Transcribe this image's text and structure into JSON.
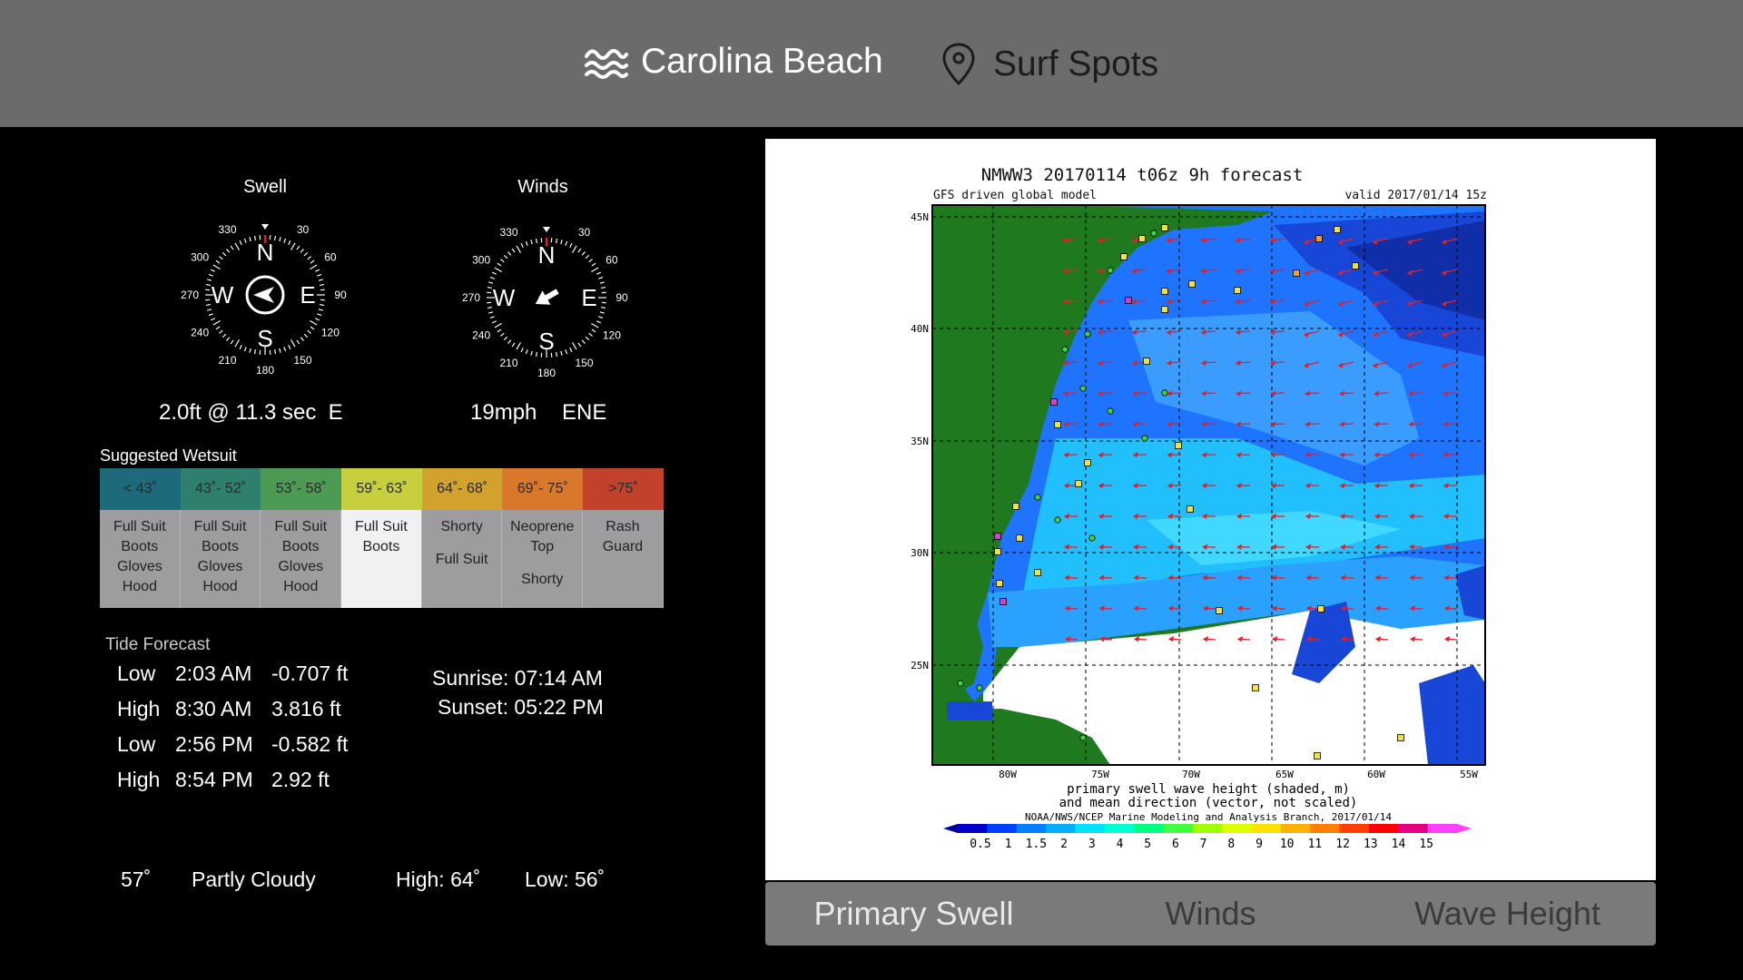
{
  "header": {
    "location_label": "Carolina Beach",
    "spots_label": "Surf Spots",
    "location_icon": "waves-icon",
    "spots_icon": "map-pin-icon"
  },
  "swell": {
    "title": "Swell",
    "readout": "2.0ft @ 11.3 sec  E",
    "direction_deg": 90
  },
  "winds": {
    "title": "Winds",
    "speed": "19mph",
    "direction": "ENE",
    "direction_deg": 60
  },
  "compass": {
    "cardinals": [
      "N",
      "E",
      "S",
      "W"
    ],
    "degree_labels": [
      "30",
      "60",
      "90",
      "120",
      "150",
      "180",
      "210",
      "240",
      "270",
      "300",
      "330"
    ]
  },
  "wetsuit": {
    "title": "Suggested Wetsuit",
    "columns": [
      {
        "range": "< 43˚",
        "color": "#1d6b7a",
        "items": [
          "Full Suit",
          "Boots",
          "Gloves",
          "Hood"
        ]
      },
      {
        "range": "43˚- 52˚",
        "color": "#2f7f6f",
        "items": [
          "Full Suit",
          "Boots",
          "Gloves",
          "Hood"
        ]
      },
      {
        "range": "53˚- 58˚",
        "color": "#4d9a55",
        "items": [
          "Full Suit",
          "Boots",
          "Gloves",
          "Hood"
        ]
      },
      {
        "range": "59˚- 63˚",
        "color": "#c8cf3e",
        "items": [
          "Full Suit",
          "Boots"
        ]
      },
      {
        "range": "64˚- 68˚",
        "color": "#d3a22e",
        "items": [
          "Shorty",
          "Full Suit"
        ]
      },
      {
        "range": "69˚- 75˚",
        "color": "#d9782b",
        "items": [
          "Neoprene",
          "Top",
          "Shorty"
        ]
      },
      {
        "range": ">75˚",
        "color": "#c2412a",
        "items": [
          "Rash",
          "Guard"
        ]
      }
    ],
    "selected_index": 3
  },
  "tide": {
    "title": "Tide Forecast",
    "entries": [
      {
        "type": "Low",
        "time": "2:03 AM",
        "height": "-0.707 ft"
      },
      {
        "type": "High",
        "time": "8:30 AM",
        "height": "3.816 ft"
      },
      {
        "type": "Low",
        "time": "2:56 PM",
        "height": "-0.582 ft"
      },
      {
        "type": "High",
        "time": "8:54 PM",
        "height": "2.92 ft"
      }
    ],
    "sunrise": "Sunrise: 07:14 AM",
    "sunset": "Sunset: 05:22 PM"
  },
  "weather": {
    "temp": "57˚",
    "condition": "Partly Cloudy",
    "high": "High: 64˚",
    "low": "Low: 56˚"
  },
  "map": {
    "title": "NMWW3  20170114  t06z        9h  forecast",
    "subtitle_left": "GFS driven global model",
    "subtitle_right": "valid 2017/01/14  15z",
    "lat_labels": [
      "45N",
      "40N",
      "35N",
      "30N",
      "25N"
    ],
    "lon_labels": [
      "80W",
      "75W",
      "70W",
      "65W",
      "60W",
      "55W"
    ],
    "caption_1": "primary swell wave height (shaded, m)",
    "caption_2": "and mean direction (vector, not scaled)",
    "credit": "NOAA/NWS/NCEP Marine Modeling and Analysis Branch, 2017/01/14",
    "colorbar_labels": [
      "0.5",
      "1",
      "1.5",
      "2",
      "3",
      "4",
      "5",
      "6",
      "7",
      "8",
      "9",
      "10",
      "11",
      "12",
      "13",
      "14",
      "15"
    ],
    "colorbar_colors": [
      "#0000c8",
      "#0040ff",
      "#0080ff",
      "#00b0ff",
      "#00e0ff",
      "#00ffd0",
      "#00ff80",
      "#40ff40",
      "#a0ff00",
      "#e0ff00",
      "#ffe000",
      "#ffb000",
      "#ff8000",
      "#ff4000",
      "#ff0000",
      "#e00080",
      "#ff40ff"
    ]
  },
  "segments": {
    "items": [
      "Primary Swell",
      "Winds",
      "Wave Height"
    ],
    "selected_index": 0
  }
}
